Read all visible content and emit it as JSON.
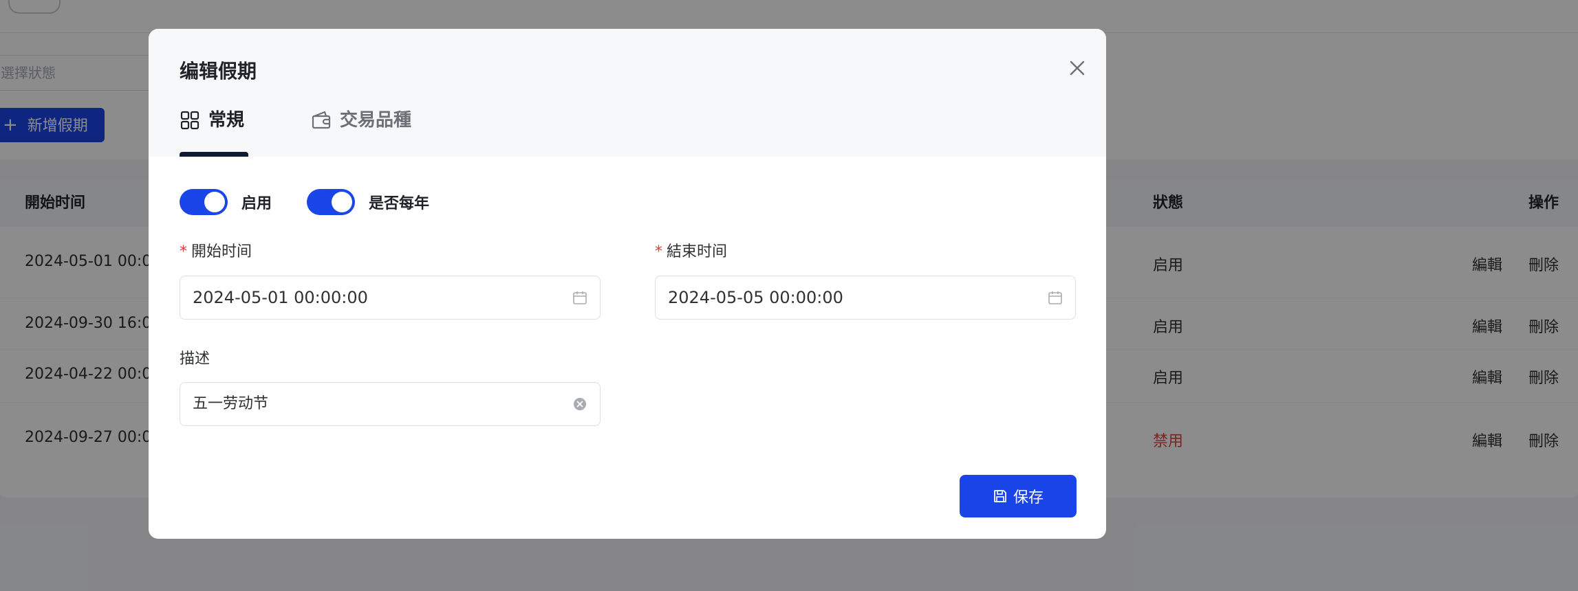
{
  "background": {
    "status_placeholder": "選擇狀態",
    "add_button_label": "新增假期",
    "table": {
      "headers": {
        "start_time": "開始时间",
        "status": "狀態",
        "actions": "操作"
      },
      "rows": [
        {
          "start": "2024-05-01 00:0",
          "status": "启用",
          "status_kind": "on",
          "edit": "編輯",
          "delete": "刪除"
        },
        {
          "start": "2024-09-30 16:0",
          "status": "启用",
          "status_kind": "on",
          "edit": "編輯",
          "delete": "刪除"
        },
        {
          "start": "2024-04-22 00:0",
          "status": "启用",
          "status_kind": "on",
          "edit": "編輯",
          "delete": "刪除"
        },
        {
          "start": "2024-09-27 00:0",
          "status": "禁用",
          "status_kind": "off",
          "edit": "編輯",
          "delete": "刪除"
        }
      ]
    }
  },
  "dialog": {
    "title": "编辑假期",
    "tabs": [
      {
        "label": "常規",
        "icon": "grid-icon",
        "active": true
      },
      {
        "label": "交易品種",
        "icon": "wallet-icon",
        "active": false
      }
    ],
    "switches": [
      {
        "label": "启用",
        "on": true
      },
      {
        "label": "是否每年",
        "on": true
      }
    ],
    "start_time": {
      "label": "開始时间",
      "required": "*",
      "value": "2024-05-01 00:00:00"
    },
    "end_time": {
      "label": "結束时间",
      "required": "*",
      "value": "2024-05-05 00:00:00"
    },
    "description": {
      "label": "描述",
      "value": "五一劳动节"
    },
    "save_label": "保存"
  },
  "colors": {
    "primary": "#1a45e8",
    "danger": "#e0423c",
    "tab_indicator": "#101a33"
  }
}
